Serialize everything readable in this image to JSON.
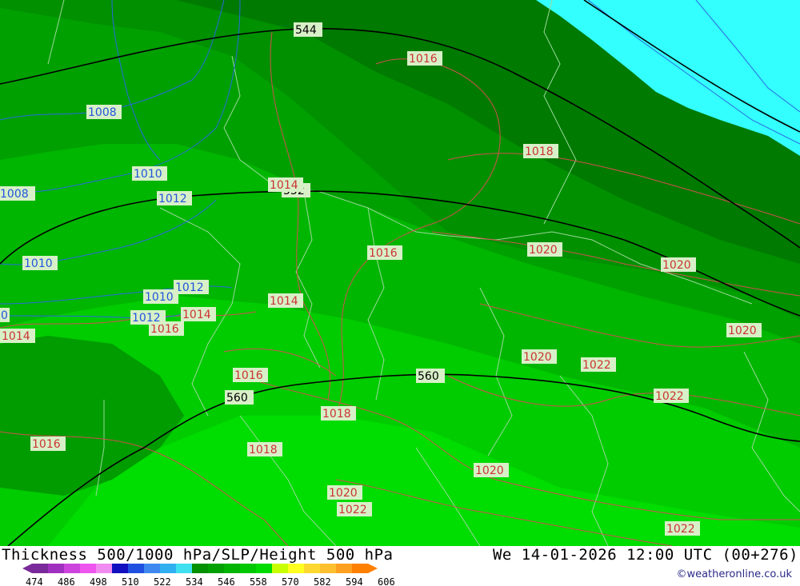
{
  "title": "Thickness 500/1000 hPa/SLP/Height 500 hPa",
  "datetime": "We 14-01-2026 12:00 UTC (00+276)",
  "credit": "©weatheronline.co.uk",
  "legend": {
    "ticks": [
      "474",
      "486",
      "498",
      "510",
      "522",
      "534",
      "546",
      "558",
      "570",
      "582",
      "594",
      "606"
    ],
    "colors": [
      "#7a2a9a",
      "#a030c0",
      "#cc44dd",
      "#ee55ee",
      "#f08cf0",
      "#1010c0",
      "#2050e0",
      "#3f88f0",
      "#30b0f0",
      "#40e0f0",
      "#009000",
      "#00a000",
      "#00b400",
      "#00c800",
      "#00dc00",
      "#c8ff00",
      "#ffff20",
      "#ffd830",
      "#ffc030",
      "#ffa020",
      "#ff8000"
    ]
  },
  "map": {
    "height_labels": [
      {
        "text": "544"
      },
      {
        "text": "552"
      },
      {
        "text": "560"
      },
      {
        "text": "560"
      }
    ],
    "slp_labels_red": [
      {
        "text": "1016"
      },
      {
        "text": "1018"
      },
      {
        "text": "1014"
      },
      {
        "text": "1016"
      },
      {
        "text": "1020"
      },
      {
        "text": "1020"
      },
      {
        "text": "1014"
      },
      {
        "text": "1014"
      },
      {
        "text": "1016"
      },
      {
        "text": "1014"
      },
      {
        "text": "1020"
      },
      {
        "text": "1022"
      },
      {
        "text": "1020"
      },
      {
        "text": "1016"
      },
      {
        "text": "1022"
      },
      {
        "text": "1018"
      },
      {
        "text": "1016"
      },
      {
        "text": "1018"
      },
      {
        "text": "1020"
      },
      {
        "text": "1020"
      },
      {
        "text": "1022"
      },
      {
        "text": "1022"
      }
    ],
    "slp_labels_blue": [
      {
        "text": "1008"
      },
      {
        "text": "1010"
      },
      {
        "text": "1008"
      },
      {
        "text": "1012"
      },
      {
        "text": "1010"
      },
      {
        "text": "1012"
      },
      {
        "text": "1010"
      },
      {
        "text": "1012"
      },
      {
        "text": "0"
      }
    ],
    "fill_colors": {
      "sea": "#33ffff",
      "dark": "#008000",
      "mid_dark": "#009400",
      "mid": "#00a800",
      "mid_light": "#00bb00",
      "light": "#00cc00",
      "lighter": "#00dd00"
    }
  }
}
